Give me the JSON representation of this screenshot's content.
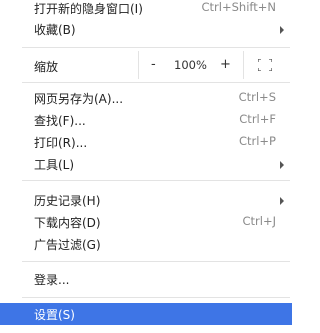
{
  "menu": {
    "incognito": {
      "label": "打开新的隐身窗口(I)",
      "shortcut": "Ctrl+Shift+N"
    },
    "bookmarks": {
      "label": "收藏(B)"
    },
    "zoom": {
      "label": "缩放",
      "minus": "-",
      "value": "100%",
      "plus": "+"
    },
    "save_as": {
      "label": "网页另存为(A)...",
      "shortcut": "Ctrl+S"
    },
    "find": {
      "label": "查找(F)...",
      "shortcut": "Ctrl+F"
    },
    "print": {
      "label": "打印(R)...",
      "shortcut": "Ctrl+P"
    },
    "tools": {
      "label": "工具(L)"
    },
    "history": {
      "label": "历史记录(H)"
    },
    "downloads": {
      "label": "下载内容(D)",
      "shortcut": "Ctrl+J"
    },
    "adblock": {
      "label": "广告过滤(G)"
    },
    "login": {
      "label": "登录..."
    },
    "settings": {
      "label": "设置(S)"
    },
    "colors": {
      "highlight": "#3e75e6"
    }
  }
}
